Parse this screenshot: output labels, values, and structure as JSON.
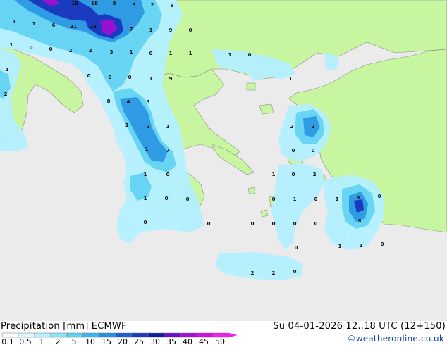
{
  "footer": {
    "title_left": "Precipitation [mm]  ECMWF",
    "title_right": "Su 04-01-2026 12..18 UTC (12+150)",
    "credit": "©weatheronline.co.uk"
  },
  "legend": {
    "ticks": [
      "0.1",
      "0.5",
      "1",
      "2",
      "5",
      "10",
      "15",
      "20",
      "25",
      "30",
      "35",
      "40",
      "45",
      "50"
    ],
    "colors": [
      "#ffffff",
      "#e0f8ff",
      "#b4f0ff",
      "#8ce4fa",
      "#5fd2f3",
      "#3cb8ee",
      "#2590e0",
      "#1e5fd0",
      "#1a3bbf",
      "#0f1d9a",
      "#6a0fc8",
      "#a20fd8",
      "#d10ee0",
      "#f01ef0"
    ]
  },
  "map_values": [
    {
      "t": "18"
    },
    {
      "t": "18"
    },
    {
      "t": "8"
    },
    {
      "t": "3"
    },
    {
      "t": "2"
    },
    {
      "t": "6"
    },
    {
      "t": "1"
    },
    {
      "t": "1"
    },
    {
      "t": "6"
    },
    {
      "t": "21"
    },
    {
      "t": "22"
    },
    {
      "t": "7"
    },
    {
      "t": "1"
    },
    {
      "t": "9"
    },
    {
      "t": "0"
    },
    {
      "t": "1"
    },
    {
      "t": "0"
    },
    {
      "t": "0"
    },
    {
      "t": "2"
    },
    {
      "t": "2"
    },
    {
      "t": "3"
    },
    {
      "t": "1"
    },
    {
      "t": "0"
    },
    {
      "t": "1"
    },
    {
      "t": "1"
    },
    {
      "t": "1"
    },
    {
      "t": "0"
    },
    {
      "t": "1"
    },
    {
      "t": "0"
    },
    {
      "t": "0"
    },
    {
      "t": "0"
    },
    {
      "t": "1"
    },
    {
      "t": "9"
    },
    {
      "t": "1"
    },
    {
      "t": "2"
    },
    {
      "t": "8"
    },
    {
      "t": "4"
    },
    {
      "t": "3"
    },
    {
      "t": "1"
    },
    {
      "t": "2"
    },
    {
      "t": "1"
    },
    {
      "t": "2"
    },
    {
      "t": "2"
    },
    {
      "t": "1"
    },
    {
      "t": "7"
    },
    {
      "t": "0"
    },
    {
      "t": "0"
    },
    {
      "t": "1"
    },
    {
      "t": "0"
    },
    {
      "t": "1"
    },
    {
      "t": "0"
    },
    {
      "t": "2"
    },
    {
      "t": "1"
    },
    {
      "t": "0"
    },
    {
      "t": "0"
    },
    {
      "t": "0"
    },
    {
      "t": "1"
    },
    {
      "t": "0"
    },
    {
      "t": "1"
    },
    {
      "t": "8"
    },
    {
      "t": "0"
    },
    {
      "t": "0"
    },
    {
      "t": "0"
    },
    {
      "t": "0"
    },
    {
      "t": "0"
    },
    {
      "t": "0"
    },
    {
      "t": "0"
    },
    {
      "t": "8"
    },
    {
      "t": "0"
    },
    {
      "t": "1"
    },
    {
      "t": "1"
    },
    {
      "t": "0"
    },
    {
      "t": "2"
    },
    {
      "t": "2"
    },
    {
      "t": "0"
    }
  ]
}
